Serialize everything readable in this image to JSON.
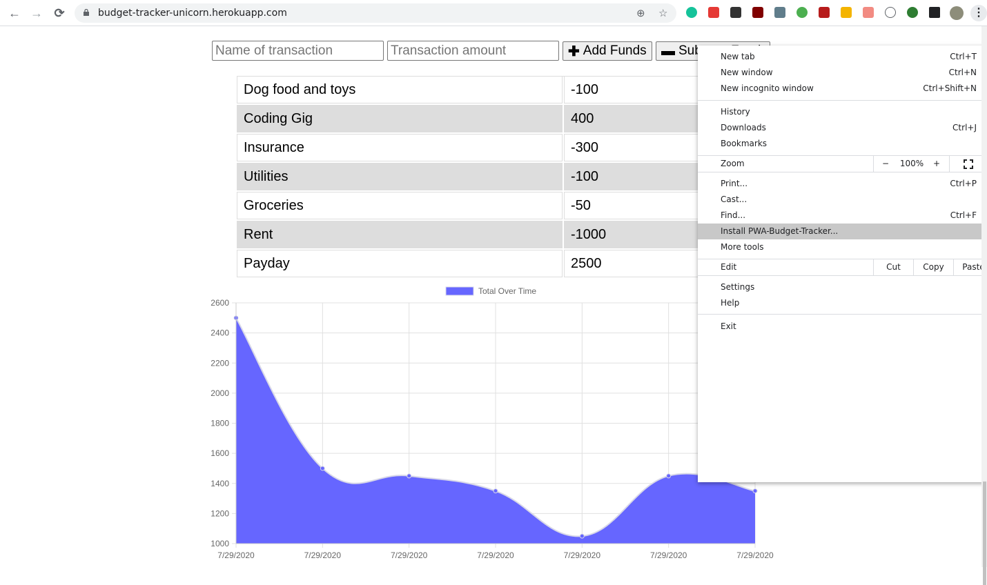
{
  "browser": {
    "url": "budget-tracker-unicorn.herokuapp.com",
    "back": "←",
    "forward": "→",
    "reload": "⟳",
    "install_icon": "⊕",
    "bookmark_star": "☆",
    "menu": "⋮"
  },
  "form": {
    "name_placeholder": "Name of transaction",
    "amount_placeholder": "Transaction amount",
    "add_symbol": "✚",
    "add_label": "Add Funds",
    "sub_symbol": "▬",
    "sub_label": "Subtract Funds"
  },
  "transactions": [
    {
      "name": "Dog food and toys",
      "value": "-100"
    },
    {
      "name": "Coding Gig",
      "value": "400"
    },
    {
      "name": "Insurance",
      "value": "-300"
    },
    {
      "name": "Utilities",
      "value": "-100"
    },
    {
      "name": "Groceries",
      "value": "-50"
    },
    {
      "name": "Rent",
      "value": "-1000"
    },
    {
      "name": "Payday",
      "value": "2500"
    }
  ],
  "chart_data": {
    "type": "area",
    "legend": "Total Over Time",
    "legend_position": "top",
    "color": "#6666ff",
    "x": [
      "7/29/2020",
      "7/29/2020",
      "7/29/2020",
      "7/29/2020",
      "7/29/2020",
      "7/29/2020",
      "7/29/2020"
    ],
    "values": [
      2500,
      1500,
      1450,
      1350,
      1050,
      1450,
      1350
    ],
    "y_ticks": [
      2600,
      2400,
      2200,
      2000,
      1800,
      1600,
      1400,
      1200,
      1000
    ],
    "ylim": [
      1000,
      2600
    ],
    "grid": true
  },
  "menu": {
    "new_tab": {
      "label": "New tab",
      "shortcut": "Ctrl+T"
    },
    "new_window": {
      "label": "New window",
      "shortcut": "Ctrl+N"
    },
    "new_incognito": {
      "label": "New incognito window",
      "shortcut": "Ctrl+Shift+N"
    },
    "history": {
      "label": "History"
    },
    "downloads": {
      "label": "Downloads",
      "shortcut": "Ctrl+J"
    },
    "bookmarks": {
      "label": "Bookmarks"
    },
    "zoom": {
      "label": "Zoom",
      "minus": "−",
      "level": "100%",
      "plus": "+"
    },
    "print": {
      "label": "Print...",
      "shortcut": "Ctrl+P"
    },
    "cast": {
      "label": "Cast..."
    },
    "find": {
      "label": "Find...",
      "shortcut": "Ctrl+F"
    },
    "install": {
      "label": "Install PWA-Budget-Tracker..."
    },
    "more_tools": {
      "label": "More tools"
    },
    "edit": {
      "label": "Edit",
      "cut": "Cut",
      "copy": "Copy",
      "paste": "Paste"
    },
    "settings": {
      "label": "Settings"
    },
    "help": {
      "label": "Help"
    },
    "exit": {
      "label": "Exit"
    }
  }
}
